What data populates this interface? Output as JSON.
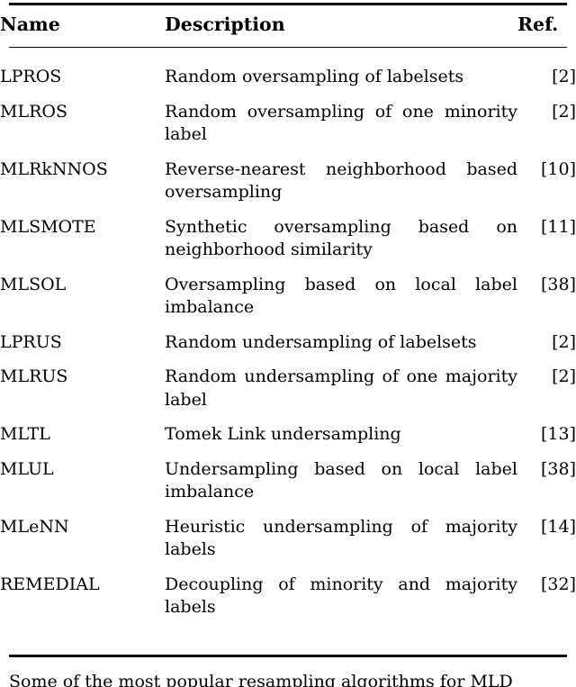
{
  "table": {
    "headers": {
      "name": "Name",
      "description": "Description",
      "ref": "Ref."
    },
    "rows": [
      {
        "name": "LPROS",
        "description": "Random oversampling of labelsets",
        "ref": "[2]",
        "multiline": false
      },
      {
        "name": "MLROS",
        "description": "Random oversampling of one minor­ity label",
        "ref": "[2]",
        "multiline": true
      },
      {
        "name": "MLRkNNOS",
        "description": "Reverse-nearest neighborhood based oversampling",
        "ref": "[10]",
        "multiline": true
      },
      {
        "name": "MLSMOTE",
        "description": "Synthetic oversampling based on neighborhood similarity",
        "ref": "[11]",
        "multiline": true
      },
      {
        "name": "MLSOL",
        "description": "Oversampling based on local label imbalance",
        "ref": "[38]",
        "multiline": true
      },
      {
        "name": "LPRUS",
        "description": "Random undersampling of labelsets",
        "ref": "[2]",
        "multiline": false
      },
      {
        "name": "MLRUS",
        "description": "Random undersampling of one ma­jority label",
        "ref": "[2]",
        "multiline": true
      },
      {
        "name": "MLTL",
        "description": "Tomek Link undersampling",
        "ref": "[13]",
        "multiline": false
      },
      {
        "name": "MLUL",
        "description": "Undersampling based on local label imbalance",
        "ref": "[38]",
        "multiline": true
      },
      {
        "name": "MLeNN",
        "description": "Heuristic undersampling of majority labels",
        "ref": "[14]",
        "multiline": true
      },
      {
        "name": "REMEDIAL",
        "description": "Decoupling of minority and majority labels",
        "ref": "[32]",
        "multiline": true
      }
    ]
  },
  "caption": {
    "text": "Some of the most popular resampling algorithms for MLD"
  }
}
